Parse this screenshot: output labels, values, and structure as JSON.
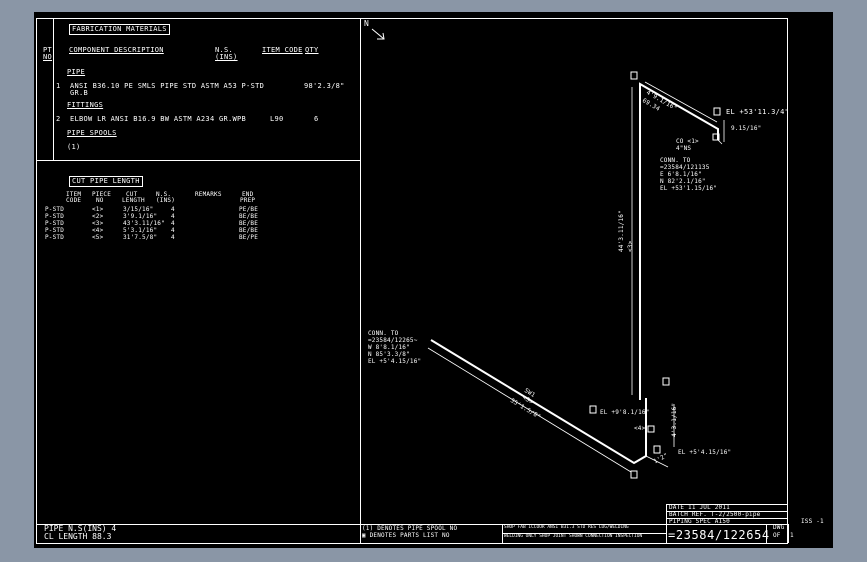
{
  "fab": {
    "title": "FABRICATION MATERIALS",
    "pt_no_1": "PT",
    "pt_no_2": "NO",
    "col_desc": "COMPONENT DESCRIPTION",
    "col_ns_1": "N.S.",
    "col_ns_2": "(INS)",
    "col_item": "ITEM CODE",
    "col_qty": "QTY",
    "sec_pipe": "PIPE",
    "row1_no": "1",
    "row1_desc": "ANSI B36.10 PE SMLS PIPE STD ASTM A53 P-STD",
    "row1_desc2": "GR.B",
    "row1_qty": "98'2.3/8\"",
    "sec_fittings": "FITTINGS",
    "row2_no": "2",
    "row2_desc": "ELBOW LR ANSI B16.9 BW ASTM A234 GR.WPB",
    "row2_code": "L90",
    "row2_qty": "6",
    "sec_spools": "PIPE SPOOLS",
    "spool": "(1)"
  },
  "cut": {
    "title": "CUT PIPE LENGTH",
    "h1a": "ITEM",
    "h1b": "CODE",
    "h2a": "PIECE",
    "h2b": "NO",
    "h3a": "CUT",
    "h3b": "LENGTH",
    "h4a": "N.S.",
    "h4b": "(INS)",
    "h5": "REMARKS",
    "h6a": "END",
    "h6b": "PREP",
    "rows": [
      {
        "code": "P-STD",
        "piece": "<1>",
        "len": "3/15/16\"",
        "ns": "4",
        "end": "PE/BE"
      },
      {
        "code": "P-STD",
        "piece": "<2>",
        "len": "3'9.1/16\"",
        "ns": "4",
        "end": "BE/BE"
      },
      {
        "code": "P-STD",
        "piece": "<3>",
        "len": "43'3.11/16\"",
        "ns": "4",
        "end": "BE/BE"
      },
      {
        "code": "P-STD",
        "piece": "<4>",
        "len": "5'3.1/16\"",
        "ns": "4",
        "end": "BE/BE"
      },
      {
        "code": "P-STD",
        "piece": "<5>",
        "len": "31'7.5/8\"",
        "ns": "4",
        "end": "BE/PE"
      }
    ]
  },
  "footer": {
    "pipe_ns": "PIPE N.S(INS)   4",
    "cl_length": "CL LENGTH 88.3",
    "note1": "(1) DENOTES PIPE SPOOL NO",
    "note2": "▣ DENOTES PARTS LIST NO"
  },
  "title_block": {
    "date": "DATE 11 JUL 2011",
    "batch": "BATCH REF. T-2/2500-pipe",
    "piping_spec": "PIPING SPEC A150",
    "small1": "SHOP FAB ICCOOR ANSI B31.3  STD  RES  LUG/WELDING",
    "small2": "WELDING ONLY  SHOP JOINT SHOWN  CONNECTION  INSPECTION",
    "drawing_no": "=23584/122654",
    "dwg": "DWG",
    "of": "OF",
    "one": "1",
    "iss": "ISS -1"
  },
  "iso": {
    "north": "N",
    "dim_top": "4'9.1/16\"",
    "dim_top2": "69.34",
    "el_top": "EL +53'11.3/4\"",
    "dim_right": "9.15/16\"",
    "co": "CO <1>",
    "co_ns": "4\"NS",
    "conn1_a": "CONN. TO",
    "conn1_b": "=23584/121135",
    "conn1_c": "E 6'8.1/16\"",
    "conn1_d": "N 82'2.1/16\"",
    "conn1_e": "EL +53'1.15/16\"",
    "vert_len": "44'3.11/16\"",
    "piece3": "<3>",
    "conn2_a": "CONN. TO",
    "conn2_b": "=23584/12265~",
    "conn2_c": "W 8'8.1/16\"",
    "conn2_d": "N 85'3.3/8\"",
    "conn2_e": "EL +5'4.15/16\"",
    "diag_len": "35'1.5/8\"",
    "diag_tag": "SW1",
    "diag_tag2": "<5>",
    "el_mid": "EL +9'8.1/16\"",
    "piece4": "<4>",
    "dim_small": "4'3.1/16\"",
    "el_bottom": "EL +5'4.15/16\"",
    "dim_bot": "1'2\"",
    "tag1": "1",
    "tag2": "2"
  }
}
